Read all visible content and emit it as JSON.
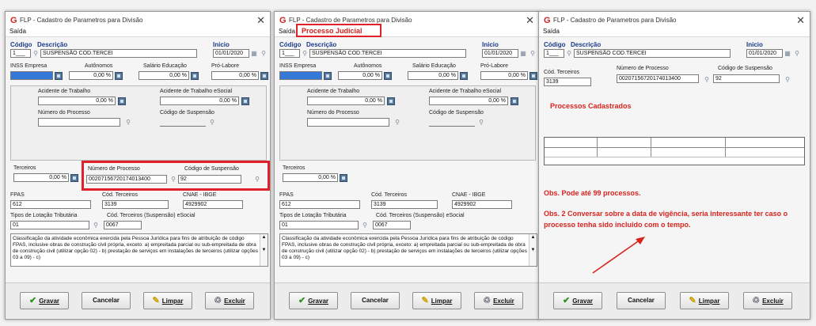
{
  "window": {
    "title": "FLP - Cadastro de Parametros para Divisão",
    "app_icon": "G",
    "close_glyph": "✕"
  },
  "menu": {
    "saida": "Saída",
    "processo_judicial": "Processo Judicial"
  },
  "header": {
    "codigo_label": "Código",
    "codigo_value": "1___",
    "descricao_label": "Descrição",
    "descricao_value": "SUSPENSÃO COD.TERCEI",
    "inicio_label": "Inicio",
    "inicio_value": "01/01/2020"
  },
  "contrib": {
    "inss_label": "INSS Empresa",
    "autonomos_label": "Autônomos",
    "autonomos_value": "0,00 %",
    "salario_label": "Salário Educação",
    "salario_value": "0,00 %",
    "prolabore_label": "Pró-Labore",
    "prolabore_value": "0,00 %"
  },
  "acidente": {
    "trabalho_label": "Acidente de Trabalho",
    "trabalho_value": "0,00 %",
    "esocial_label": "Acidente de Trabalho eSocial",
    "esocial_value": "0,00 %",
    "processo_label": "Número do Processo",
    "suspensao_label": "Código de Suspensão"
  },
  "terceiros": {
    "label": "Terceiros",
    "value": "0,00 %",
    "processo_label": "Número de Processo",
    "processo_value": "00207156720174013400",
    "suspensao_label": "Código de Suspensão",
    "suspensao_value": "92"
  },
  "fpas": {
    "fpas_label": "FPAS",
    "fpas_value": "612",
    "terceiros_label": "Cód. Terceiros",
    "terceiros_value": "3139",
    "cnae_label": "CNAE - IBGE",
    "cnae_value": "4929902"
  },
  "lotacao": {
    "tipos_label": "Tipos de Lotação Tributária",
    "tipos_value": "01",
    "esocial_label": "Cód. Terceiros (Suspensão) eSocial",
    "esocial_value": "0067"
  },
  "description_text": "Classificação da atividade econômica exercida pela Pessoa Jurídica para fins de atribuição de código FPAS, inclusive obras de construção civil própria, exceto: a) empreitada parcial ou sub-empreitada de obra de construção civil (utilizar opção 02) - b) prestação de serviços em instalações de terceiros (utilizar opções 03 a 09) - c)",
  "buttons": {
    "gravar": "Gravar",
    "cancelar": "Cancelar",
    "limpar": "Limpar",
    "excluir": "Excluir"
  },
  "panel3": {
    "cod_terceiros_label": "Cód. Terceiros",
    "cod_terceiros_value": "3139",
    "processo_label": "Número de Processo",
    "processo_value": "00207156720174013400",
    "suspensao_label": "Código de Suspensão",
    "suspensao_value": "92",
    "cadastrados_title": "Processos Cadastrados",
    "obs1": "Obs. Pode até 99 processos.",
    "obs2": "Obs. 2 Conversar sobre a data de vigência, seria interessante ter caso o processo tenha sido incluido com o tempo."
  },
  "colors": {
    "accent_red": "#d9241e",
    "label_blue": "#1a3a8a",
    "input_blue": "#3478d8"
  }
}
